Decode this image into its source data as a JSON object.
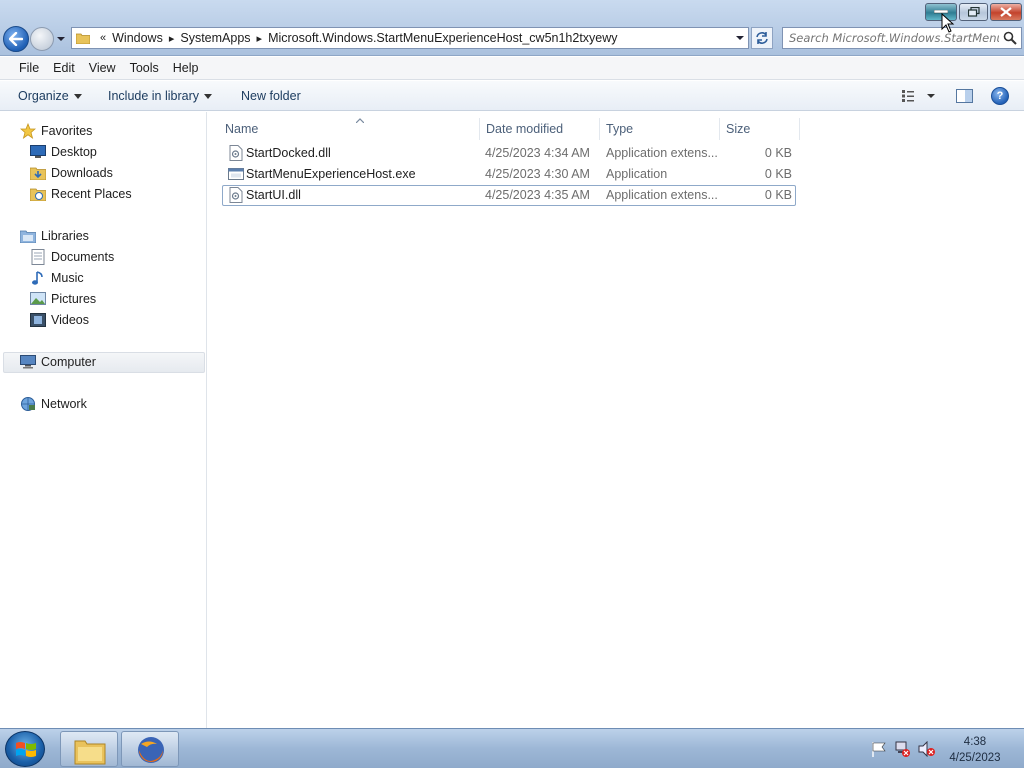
{
  "window": {
    "address_crumbs": [
      "Windows",
      "SystemApps",
      "Microsoft.Windows.StartMenuExperienceHost_cw5n1h2txyewy"
    ],
    "address_overflow": "«",
    "search_placeholder": "Search Microsoft.Windows.StartMenuE..."
  },
  "menu": {
    "items": [
      {
        "label": "File"
      },
      {
        "label": "Edit"
      },
      {
        "label": "View"
      },
      {
        "label": "Tools"
      },
      {
        "label": "Help"
      }
    ]
  },
  "commands": {
    "organize": "Organize",
    "include_in_library": "Include in library",
    "new_folder": "New folder",
    "help_glyph": "?"
  },
  "navpane": {
    "favorites": "Favorites",
    "desktop": "Desktop",
    "downloads": "Downloads",
    "recent_places": "Recent Places",
    "libraries": "Libraries",
    "documents": "Documents",
    "music": "Music",
    "pictures": "Pictures",
    "videos": "Videos",
    "computer": "Computer",
    "network": "Network"
  },
  "filelist": {
    "columns": {
      "name": "Name",
      "date": "Date modified",
      "type": "Type",
      "size": "Size"
    },
    "rows": [
      {
        "name": "StartDocked.dll",
        "date": "4/25/2023 4:34 AM",
        "type": "Application extens...",
        "size": "0 KB",
        "icon": "dll-file-icon"
      },
      {
        "name": "StartMenuExperienceHost.exe",
        "date": "4/25/2023 4:30 AM",
        "type": "Application",
        "size": "0 KB",
        "icon": "exe-file-icon"
      },
      {
        "name": "StartUI.dll",
        "date": "4/25/2023 4:35 AM",
        "type": "Application extens...",
        "size": "0 KB",
        "icon": "dll-file-icon",
        "selected": true
      }
    ]
  },
  "taskbar": {
    "clock_time": "4:38",
    "clock_date": "4/25/2023"
  },
  "colors": {
    "titlebar": "#b9cde6",
    "close_button": "#c3432c",
    "minimize_hover": "#2f7d93",
    "taskbar": "#9db7d6"
  }
}
